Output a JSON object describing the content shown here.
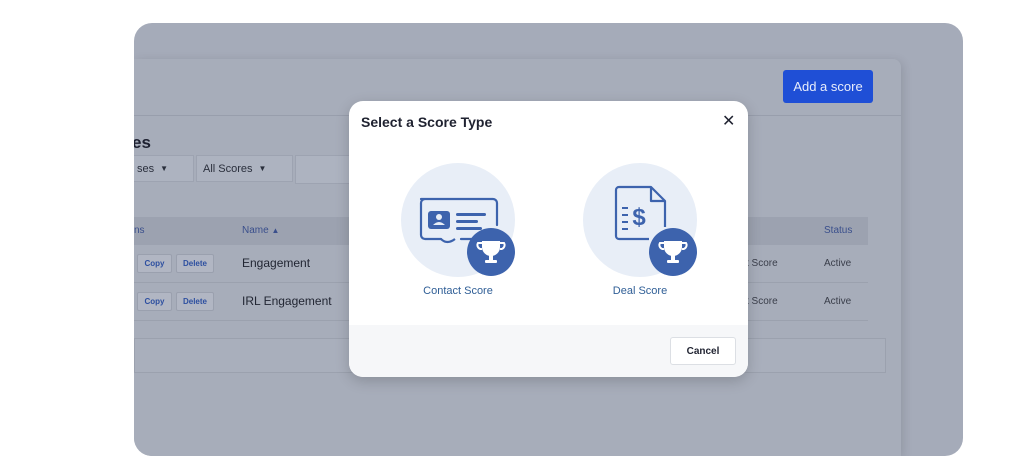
{
  "colors": {
    "primary": "#1f4fd6",
    "overlay": "#a5abb9",
    "icon_blue": "#3d63ad",
    "icon_bg": "#e8eef7",
    "link": "#2f5e96"
  },
  "header": {
    "add_score_label": "Add a score"
  },
  "page": {
    "title_fragment": "es"
  },
  "filters": [
    {
      "label": "ses",
      "icon": "caret-down-icon"
    },
    {
      "label": "All Scores",
      "icon": "caret-down-icon"
    }
  ],
  "table": {
    "columns": {
      "actions": "ns",
      "name": "Name",
      "name_sort_icon": "sort-up-icon",
      "status": "Status"
    },
    "rows": [
      {
        "copy": "Copy",
        "delete": "Delete",
        "name": "Engagement",
        "type": "t Score",
        "status": "Active"
      },
      {
        "copy": "Copy",
        "delete": "Delete",
        "name": "IRL Engagement",
        "type": "t Score",
        "status": "Active"
      }
    ]
  },
  "modal": {
    "title": "Select a Score Type",
    "close_icon": "close-icon",
    "options": [
      {
        "label": "Contact Score",
        "icon": "contact-card-trophy-icon"
      },
      {
        "label": "Deal Score",
        "icon": "invoice-trophy-icon"
      }
    ],
    "cancel_label": "Cancel"
  }
}
